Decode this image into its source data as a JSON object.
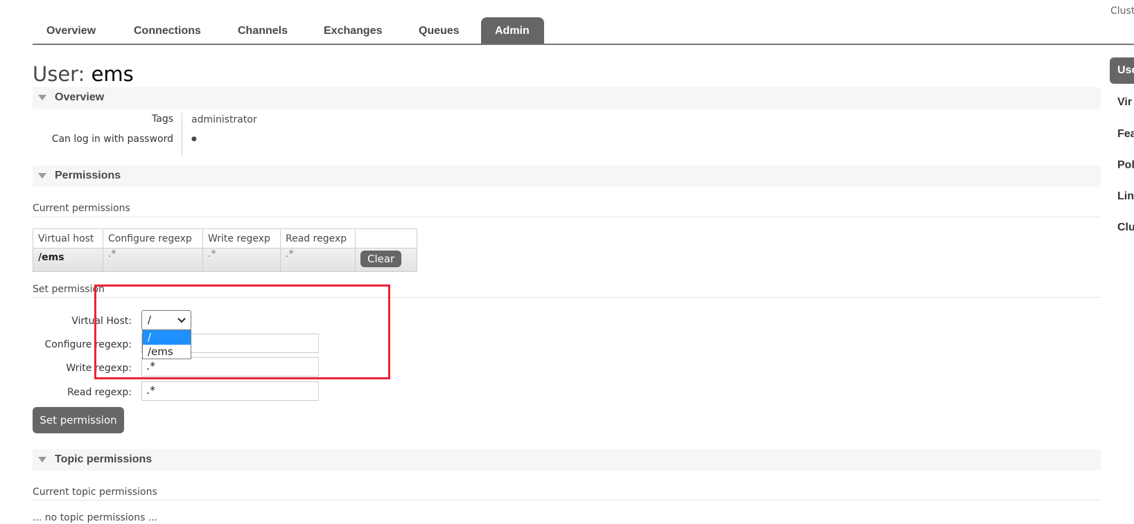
{
  "top_right": "Clust",
  "tabs": [
    {
      "label": "Overview",
      "active": false
    },
    {
      "label": "Connections",
      "active": false
    },
    {
      "label": "Channels",
      "active": false
    },
    {
      "label": "Exchanges",
      "active": false
    },
    {
      "label": "Queues",
      "active": false
    },
    {
      "label": "Admin",
      "active": true
    }
  ],
  "page_title": {
    "prefix": "User: ",
    "name": "ems"
  },
  "overview": {
    "header": "Overview",
    "rows": [
      {
        "label": "Tags",
        "value": "administrator"
      },
      {
        "label": "Can log in with password",
        "value": "●"
      }
    ]
  },
  "permissions": {
    "header": "Permissions",
    "current_label": "Current permissions",
    "columns": [
      "Virtual host",
      "Configure regexp",
      "Write regexp",
      "Read regexp",
      ""
    ],
    "rows": [
      {
        "vhost": "/ems",
        "configure": ".*",
        "write": ".*",
        "read": ".*",
        "action": "Clear"
      }
    ],
    "set_label": "Set permission",
    "form": {
      "vhost_label": "Virtual Host:",
      "vhost_value": "/",
      "vhost_options": [
        "/",
        "/ems"
      ],
      "configure_label": "Configure regexp:",
      "configure_value": ".*",
      "write_label": "Write regexp:",
      "write_value": ".*",
      "read_label": "Read regexp:",
      "read_value": ".*",
      "submit": "Set permission"
    }
  },
  "topic_permissions": {
    "header": "Topic permissions",
    "current_label": "Current topic permissions",
    "empty": "... no topic permissions ..."
  },
  "sidebar": {
    "items": [
      "Use",
      "Vir",
      "Fea",
      "Pol",
      "Lin",
      "Clu"
    ],
    "active": 0
  },
  "colors": {
    "accent": "#666666",
    "highlight": "#1e90ff",
    "annotation": "#ee2233"
  }
}
